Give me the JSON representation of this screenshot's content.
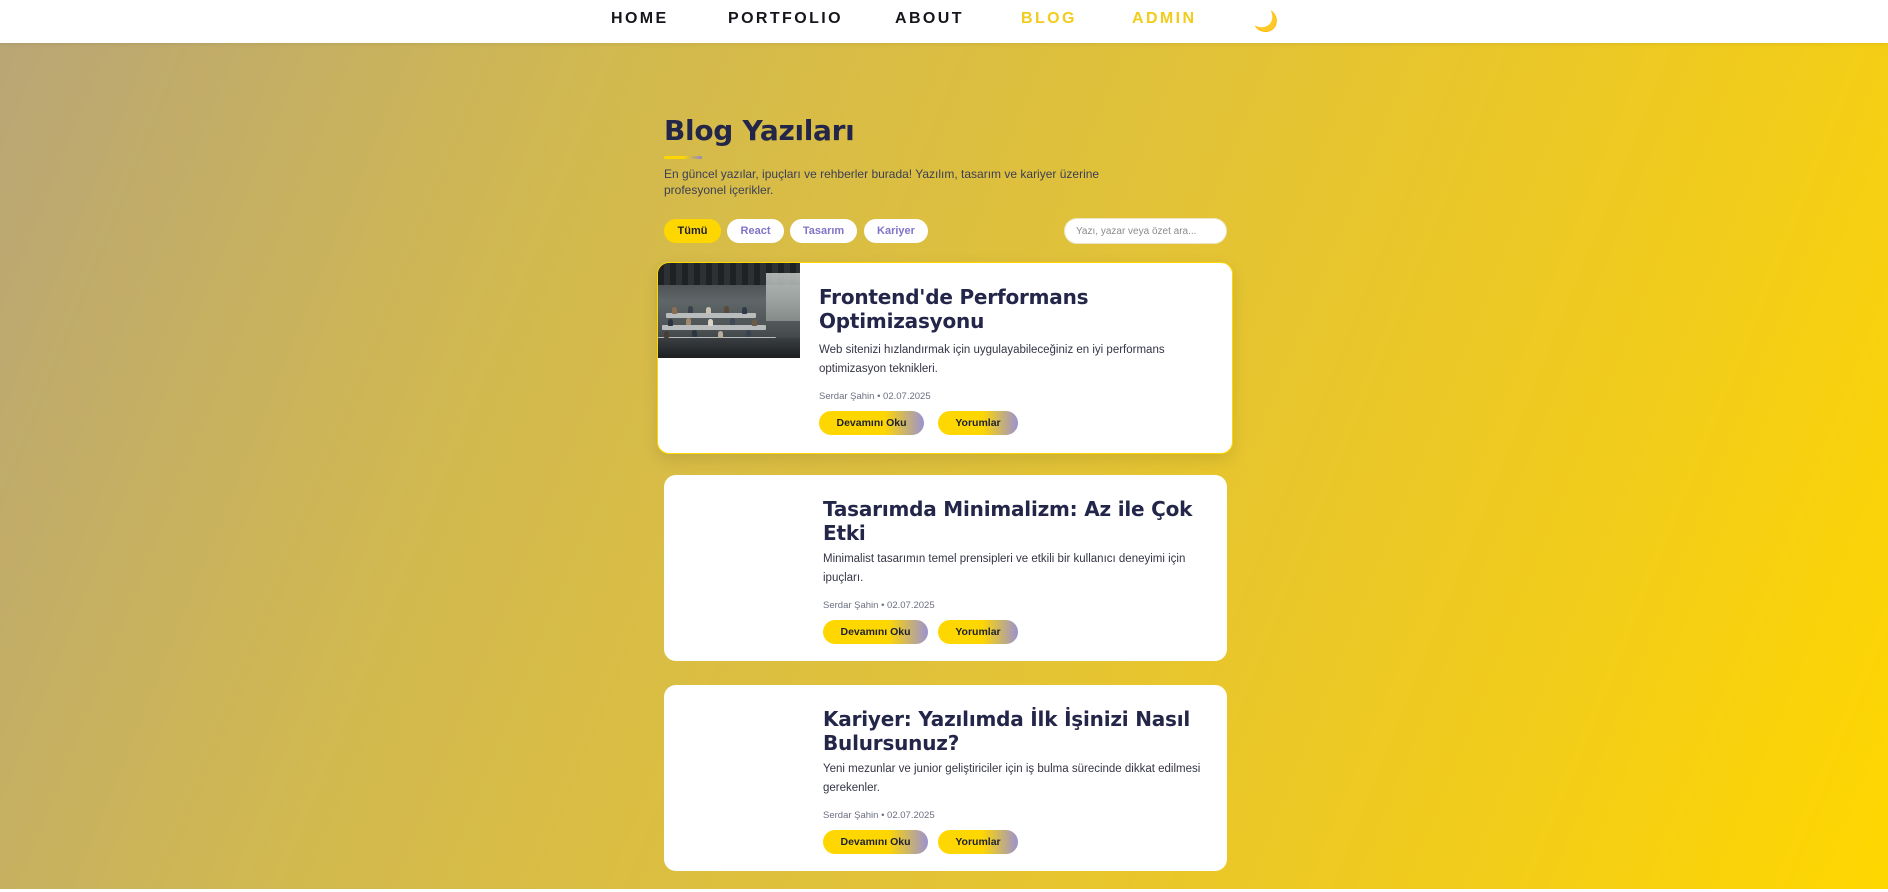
{
  "nav": {
    "items": [
      {
        "label": "HOME",
        "active": false
      },
      {
        "label": "PORTFOLIO",
        "active": false
      },
      {
        "label": "ABOUT",
        "active": false
      },
      {
        "label": "BLOG",
        "active": true
      },
      {
        "label": "ADMIN",
        "active": true
      }
    ],
    "theme_icon": "🌙",
    "theme_icon_name": "moon-icon"
  },
  "colors": {
    "accent": "#ffd700",
    "nav_active": "#f2cc1a",
    "title": "#232649",
    "chip_inactive_text": "#7f74c7"
  },
  "blog": {
    "title": "Blog Yazıları",
    "subtitle": "En güncel yazılar, ipuçları ve rehberler burada! Yazılım, tasarım ve kariyer üzerine profesyonel içerikler.",
    "filters": [
      {
        "label": "Tümü",
        "active": true
      },
      {
        "label": "React",
        "active": false
      },
      {
        "label": "Tasarım",
        "active": false
      },
      {
        "label": "Kariyer",
        "active": false
      }
    ],
    "search": {
      "placeholder": "Yazı, yazar veya özet ara...",
      "value": ""
    },
    "posts": [
      {
        "title": "Frontend'de Performans Optimizasyonu",
        "excerpt": "Web sitenizi hızlandırmak için uygulayabileceğiniz en iyi performans optimizasyon teknikleri.",
        "meta": "Serdar Şahin • 02.07.2025",
        "read_label": "Devamını Oku",
        "comments_label": "Yorumlar",
        "has_image": true,
        "highlighted": true
      },
      {
        "title": "Tasarımda Minimalizm: Az ile Çok Etki",
        "excerpt": "Minimalist tasarımın temel prensipleri ve etkili bir kullanıcı deneyimi için ipuçları.",
        "meta": "Serdar Şahin • 02.07.2025",
        "read_label": "Devamını Oku",
        "comments_label": "Yorumlar",
        "has_image": false,
        "highlighted": false
      },
      {
        "title": "Kariyer: Yazılımda İlk İşinizi Nasıl Bulursunuz?",
        "excerpt": "Yeni mezunlar ve junior geliştiriciler için iş bulma sürecinde dikkat edilmesi gerekenler.",
        "meta": "Serdar Şahin • 02.07.2025",
        "read_label": "Devamını Oku",
        "comments_label": "Yorumlar",
        "has_image": false,
        "highlighted": false
      }
    ]
  }
}
